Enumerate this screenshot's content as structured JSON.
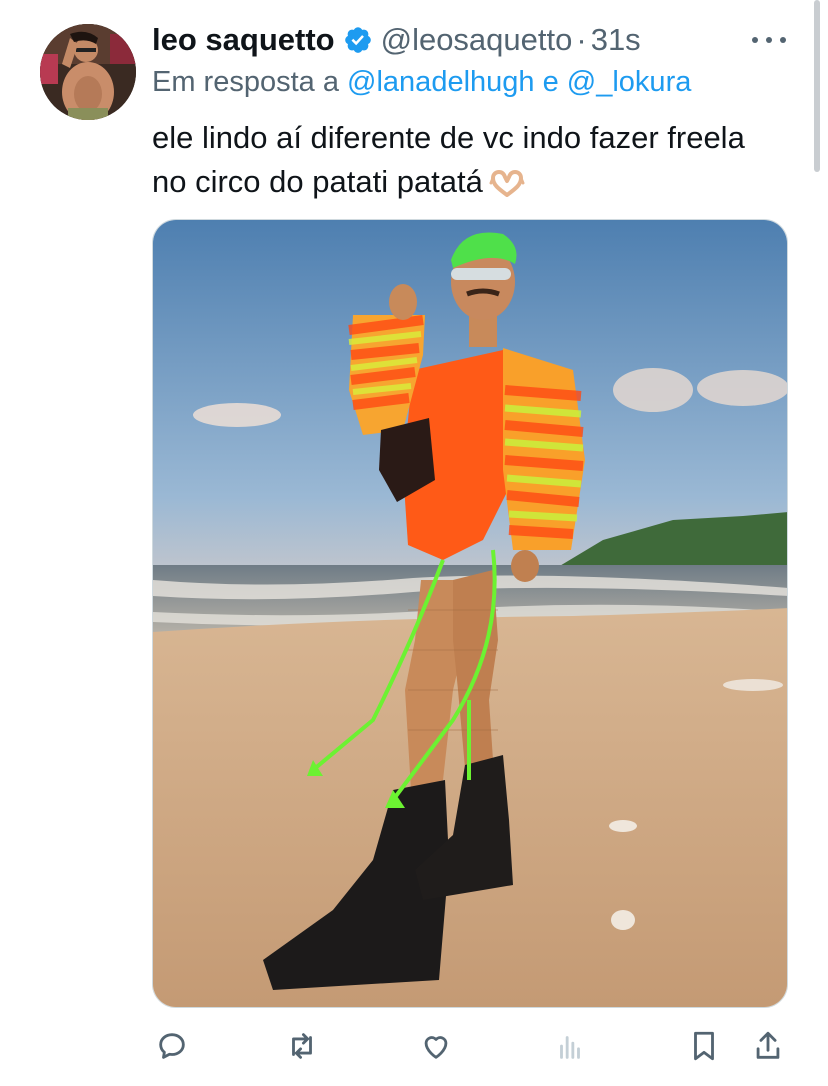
{
  "tweet": {
    "display_name": "leo saquetto",
    "handle": "@leosaquetto",
    "separator": "·",
    "time": "31s",
    "reply": {
      "prefix": "Em resposta a",
      "mention_1": "@lanadelhugh",
      "conjunction": "e",
      "mention_2": "@_lokura"
    },
    "text_line_1": "ele lindo aí diferente de vc indo fazer freela",
    "text_line_2": "no circo do patati patatá",
    "emoji": "🫶"
  },
  "colors": {
    "accent": "#1d9bf0",
    "secondary_text": "#536471",
    "primary_text": "#0f1419",
    "verified": "#1d9bf0"
  },
  "icons": {
    "verified": "verified-badge-icon",
    "more": "more-options-icon",
    "reply": "reply-icon",
    "retweet": "retweet-icon",
    "like": "like-icon",
    "views": "views-icon",
    "bookmark": "bookmark-icon",
    "share": "share-icon"
  }
}
